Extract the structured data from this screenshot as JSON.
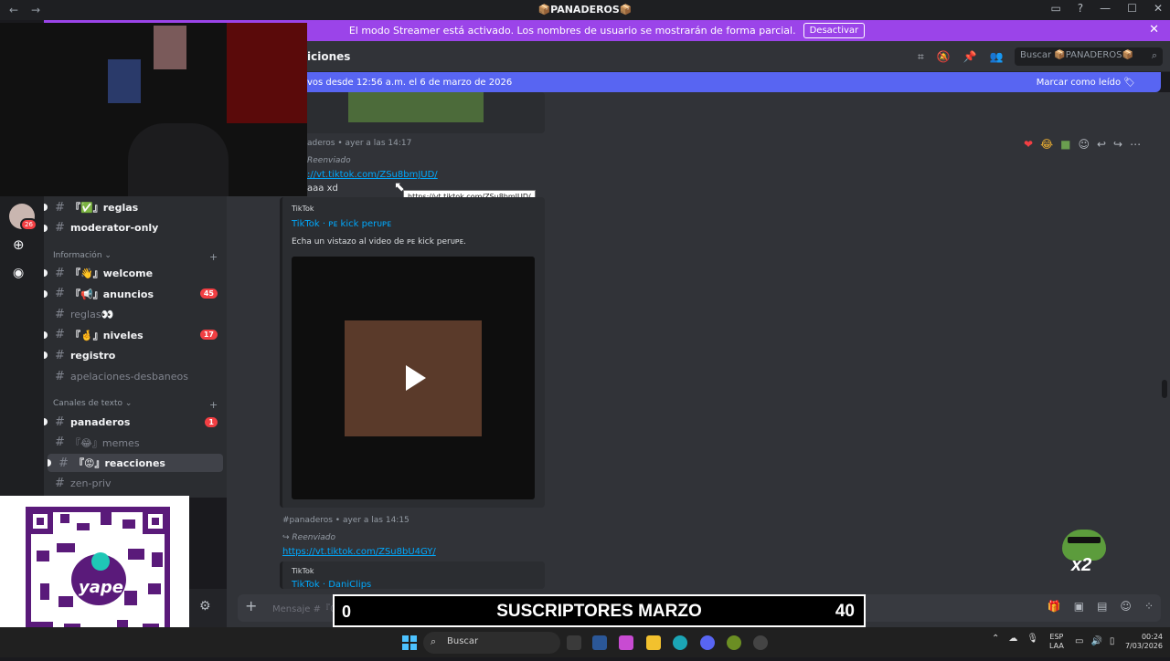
{
  "window": {
    "title": "PANADEROS",
    "back_icon": "arrow-left-icon",
    "forward_icon": "arrow-right-icon"
  },
  "streamer_banner": {
    "text": "El modo Streamer está activado. Los nombres de usuario se mostrarán de forma parcial.",
    "button": "Desactivar",
    "close": "✕"
  },
  "channel_header": {
    "name": "iciones",
    "search_placeholder": "Buscar 📦PANADEROS📦"
  },
  "new_messages_bar": {
    "text": "vos desde 12:56 a.m. el 6 de marzo de 2026",
    "action": "Marcar como leído"
  },
  "rail": {
    "badge": "26"
  },
  "sidebar": {
    "channels_top": [
      {
        "label": "『✅』reglas",
        "state": "unread",
        "badge": ""
      },
      {
        "label": "moderator-only",
        "state": "unread",
        "badge": ""
      }
    ],
    "category_info": "Información",
    "channels_info": [
      {
        "label": "『👋』welcome",
        "state": "unread",
        "badge": ""
      },
      {
        "label": "『📢』anuncios",
        "state": "unread",
        "badge": "45"
      },
      {
        "label": "reglas👀",
        "state": "read",
        "badge": ""
      },
      {
        "label": "『🤞』niveles",
        "state": "unread",
        "badge": "17"
      },
      {
        "label": "registro",
        "state": "unread",
        "badge": ""
      },
      {
        "label": "apelaciones-desbaneos",
        "state": "read",
        "badge": ""
      }
    ],
    "category_text": "Canales de texto",
    "channels_text": [
      {
        "label": "panaderos",
        "state": "unread",
        "badge": "1"
      },
      {
        "label": "『😂』memes",
        "state": "read",
        "badge": ""
      },
      {
        "label": "『😡』reacciones",
        "state": "selected",
        "badge": ""
      },
      {
        "label": "zen-priv",
        "state": "read",
        "badge": ""
      }
    ]
  },
  "messages": [
    {
      "meta": "aderos • ayer a las 14:17",
      "forwarded": "Reenviado",
      "link": "://vt.tiktok.com/ZSu8bmJUD/",
      "text": "aaa xd",
      "tooltip": "https://vt.tiktok.com/ZSu8bmJUD/",
      "embed": {
        "provider": "TikTok",
        "title": "TikTok · ᴘᴇ kick perᴜᴘᴇ",
        "description": "Echa un vistazo al video de ᴘᴇ kick perᴜᴘᴇ."
      }
    },
    {
      "meta": "#panaderos • ayer a las 14:15",
      "forwarded": "Reenviado",
      "link": "https://vt.tiktok.com/ZSu8bU4GY/",
      "embed": {
        "provider": "TikTok",
        "title": "TikTok · DaniClips"
      }
    }
  ],
  "composer": {
    "placeholder": "Mensaje #『😡』reacciones"
  },
  "overlay": {
    "subs_left": "0",
    "subs_title": "SUSCRIPTORES MARZO",
    "subs_right": "40",
    "pepe_label": "x2",
    "qr_label": "yape"
  },
  "taskbar": {
    "search": "Buscar",
    "lang_top": "ESP",
    "lang_bottom": "LAA",
    "time": "00:24",
    "date": "7/03/2026"
  },
  "colors": {
    "streamer": "#9b44e9",
    "accent": "#5865f2",
    "link": "#00a8fc",
    "badge": "#f23f43"
  }
}
